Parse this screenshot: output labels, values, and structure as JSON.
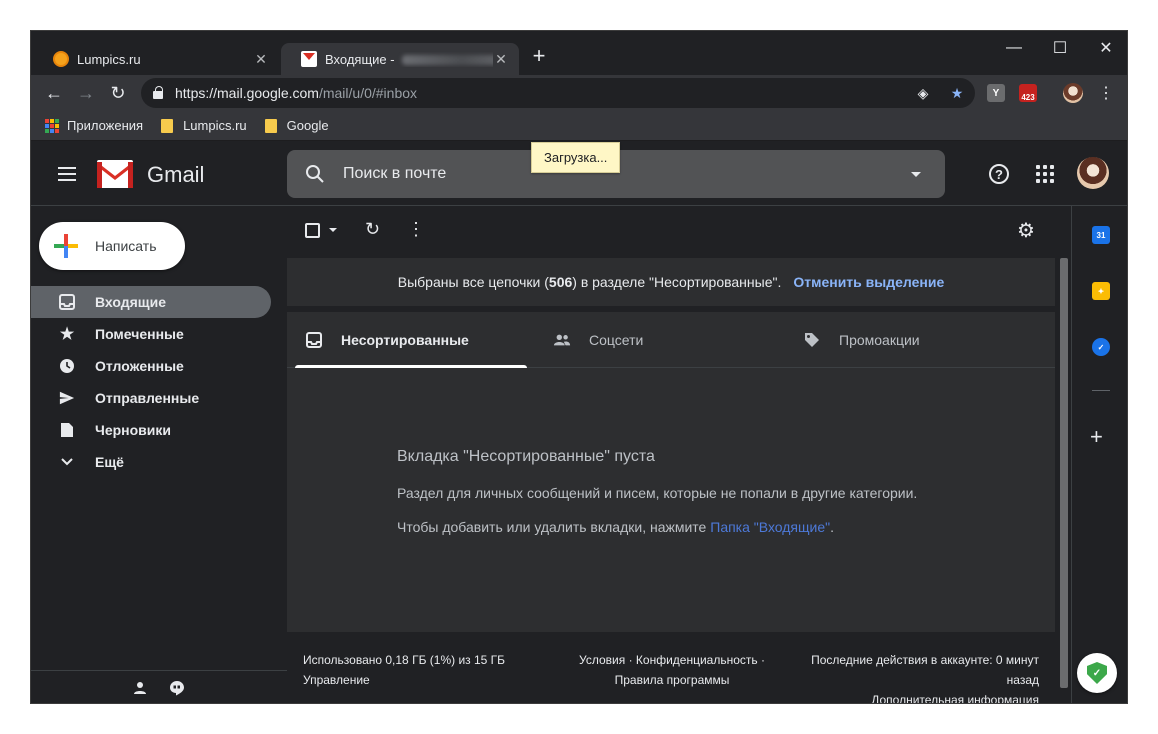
{
  "browser": {
    "tabs": [
      {
        "title": "Lumpics.ru",
        "active": false
      },
      {
        "title": "Входящие - ",
        "active": true
      }
    ],
    "url_host": "https://mail.google.com",
    "url_path": "/mail/u/0/#inbox",
    "extension_badge": "423",
    "extension_y": "Y",
    "bookmarks": [
      "Приложения",
      "Lumpics.ru",
      "Google"
    ]
  },
  "gmail": {
    "product_name": "Gmail",
    "search_placeholder": "Поиск в почте",
    "loading_tooltip": "Загрузка...",
    "compose_label": "Написать",
    "nav": [
      {
        "label": "Входящие",
        "icon": "inbox-icon",
        "active": true
      },
      {
        "label": "Помеченные",
        "icon": "star-icon",
        "active": false
      },
      {
        "label": "Отложенные",
        "icon": "clock-icon",
        "active": false
      },
      {
        "label": "Отправленные",
        "icon": "send-icon",
        "active": false
      },
      {
        "label": "Черновики",
        "icon": "draft-icon",
        "active": false
      },
      {
        "label": "Ещё",
        "icon": "chevron-down-icon",
        "active": false
      }
    ],
    "selection_bar": {
      "prefix": "Выбраны все цепочки (",
      "count": "506",
      "suffix": ") в разделе \"Несортированные\".",
      "link": "Отменить выделение"
    },
    "category_tabs": [
      {
        "label": "Несортированные",
        "active": true
      },
      {
        "label": "Соцсети",
        "active": false
      },
      {
        "label": "Промоакции",
        "active": false
      }
    ],
    "empty_state": {
      "title": "Вкладка \"Несортированные\" пуста",
      "description": "Раздел для личных сообщений и писем, которые не попали в другие категории.",
      "hint_prefix": "Чтобы добавить или удалить вкладки, нажмите ",
      "hint_link": "Папка \"Входящие\"",
      "hint_suffix": "."
    },
    "footer": {
      "storage": "Использовано 0,18 ГБ (1%) из 15 ГБ",
      "manage": "Управление",
      "terms_line1": "Условия · Конфиденциальность ·",
      "terms_line2": "Правила программы",
      "activity_line1": "Последние действия в аккаунте: 0 минут",
      "activity_line2": "назад",
      "activity_line3": "Дополнительная информация"
    },
    "side_panel": {
      "calendar_day": "31"
    }
  },
  "colors": {
    "background": "#202124",
    "surface": "#2d2e30",
    "accent_link": "#8ab4f8",
    "gmail_red": "#d93025"
  }
}
